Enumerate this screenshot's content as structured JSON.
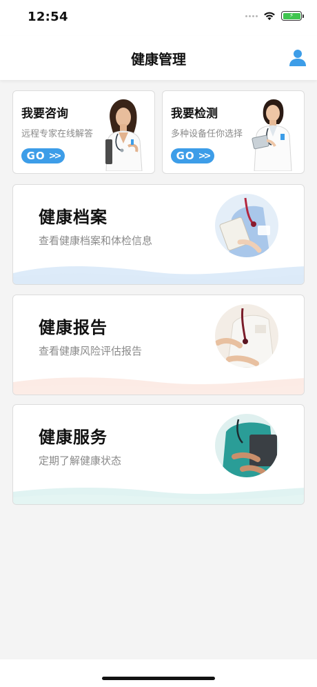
{
  "status_bar": {
    "time": "12:54",
    "icons": [
      "signal-dots-icon",
      "wifi-icon",
      "battery-charging-icon"
    ]
  },
  "nav": {
    "title": "健康管理",
    "right_icon": "user-icon"
  },
  "quick_actions": [
    {
      "title": "我要咨询",
      "subtitle": "远程专家在线解答",
      "button": "GO",
      "button_icon": "double-chevron-right-icon"
    },
    {
      "title": "我要检测",
      "subtitle": "多种设备任你选择",
      "button": "GO",
      "button_icon": "double-chevron-right-icon"
    }
  ],
  "sections": [
    {
      "title": "健康档案",
      "subtitle": "查看健康档案和体检信息",
      "accent": "#cfe3f7"
    },
    {
      "title": "健康报告",
      "subtitle": "查看健康风险评估报告",
      "accent": "#fbe3da"
    },
    {
      "title": "健康服务",
      "subtitle": "定期了解健康状态",
      "accent": "#d6efee"
    }
  ],
  "colors": {
    "brand": "#3d9de8",
    "background": "#f4f4f4"
  }
}
